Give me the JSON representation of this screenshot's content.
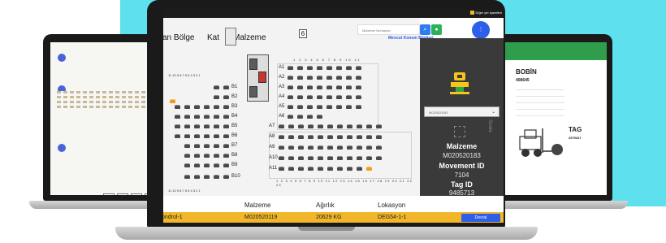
{
  "center": {
    "topbar": {
      "action_label": "Diğer yer işaretleri"
    },
    "nav": {
      "region": "ılan Bölge",
      "floor": "Kat",
      "material": "Malzeme"
    },
    "column_marker": "6",
    "search": {
      "placeholder": "Malzeme Numarası"
    },
    "link": "Mevcut Konum Bilgileri",
    "fab": "⋮",
    "row_labels_left": [
      "B1",
      "B2",
      "B3",
      "B4",
      "B5",
      "B6",
      "B7",
      "B8",
      "B9",
      "B10"
    ],
    "row_labels_right": [
      "A1",
      "A2",
      "A3",
      "A4",
      "A5",
      "A6",
      "A7",
      "A8",
      "A9",
      "A10",
      "A11"
    ],
    "left_numbers_top": "11 10 9 8 7 6 5 4 3 2 1",
    "left_numbers_bottom": "11 10 9 8 7 6 5 4 3 2 1",
    "top_axis": "1 2 3 4 5 6 7 8 9 10 11",
    "bottom_axis": "1 2 3 4 5 6 7 8 9 10 11 12 13 14 15 16 17 18 19 20 21 22 23",
    "sidebar": {
      "select_value": "M020520183",
      "material_label": "Malzeme",
      "material_value": "M020520183",
      "movement_label": "Movement ID",
      "movement_value": "7104",
      "tag_label": "Tag ID",
      "tag_value": "9485713",
      "vertical_text": "Sırala"
    },
    "table": {
      "headers": [
        "Malzeme",
        "Ağırlık",
        "Lokasyon"
      ],
      "row": {
        "name": "ondrol-1",
        "material": "M020520119",
        "weight": "20629 KG",
        "location": "DEG54-1-1"
      },
      "button": "Devral"
    }
  },
  "right": {
    "title": "BOBİN",
    "id": "408645",
    "tag_label": "TAG",
    "tag_value": "2575347"
  }
}
